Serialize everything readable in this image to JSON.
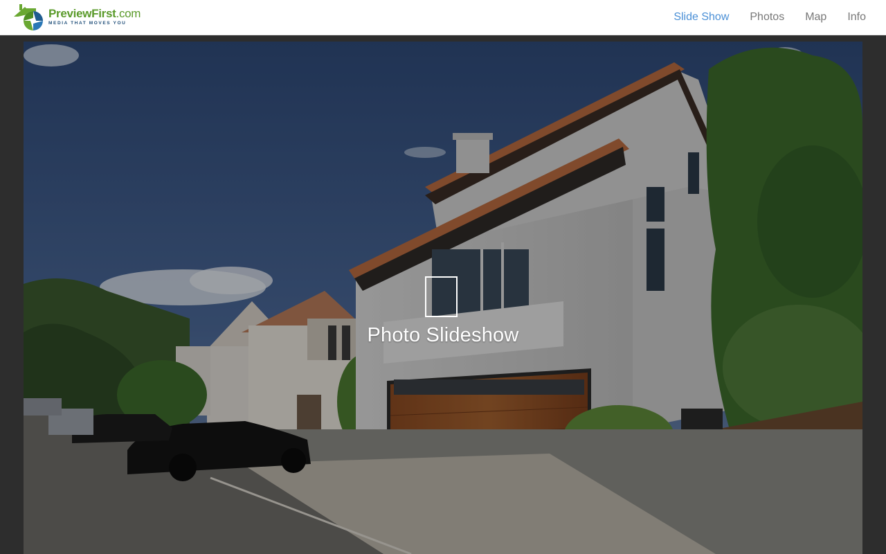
{
  "brand": {
    "name": "PreviewFirst",
    "tld": ".com",
    "tagline": "MEDIA THAT MOVES YOU"
  },
  "nav": {
    "items": [
      {
        "label": "Slide Show",
        "active": true
      },
      {
        "label": "Photos",
        "active": false
      },
      {
        "label": "Map",
        "active": false
      },
      {
        "label": "Info",
        "active": false
      }
    ]
  },
  "hero": {
    "label": "Photo Slideshow",
    "icon": "slideshow-frame-icon"
  },
  "colors": {
    "nav_active": "#4a8fd6",
    "nav_text": "#777777",
    "brand_green": "#5a9a2a",
    "brand_blue": "#1f4e79",
    "page_bg": "#2d2d2d"
  }
}
